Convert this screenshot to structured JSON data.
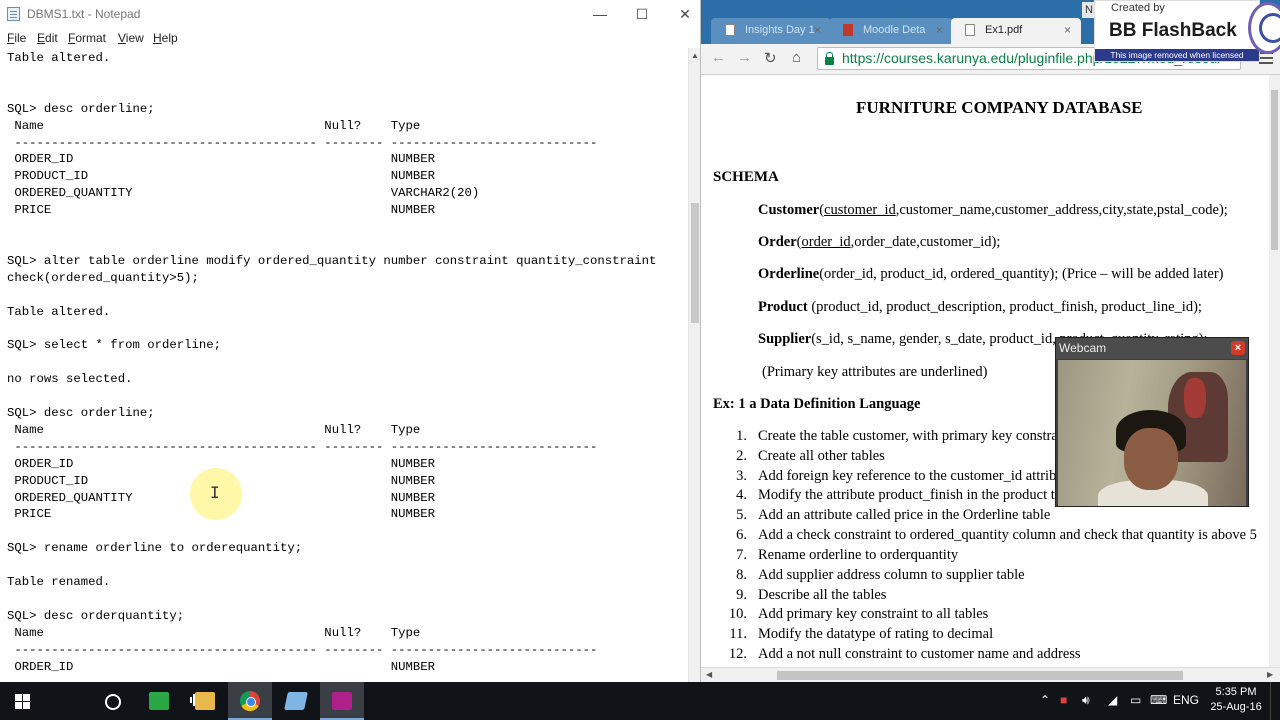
{
  "notepad": {
    "title": "DBMS1.txt - Notepad",
    "controls": {
      "minimize": "—",
      "maximize": "☐",
      "close": "✕"
    },
    "menu": [
      {
        "first": "F",
        "rest": "ile"
      },
      {
        "first": "E",
        "rest": "dit"
      },
      {
        "first": "F",
        "rest": "ormat"
      },
      {
        "first": "V",
        "rest": "iew"
      },
      {
        "first": "H",
        "rest": "elp"
      }
    ],
    "content": "Table altered.\n\n\nSQL> desc orderline;\n Name                                      Null?    Type\n ----------------------------------------- -------- ----------------------------\n ORDER_ID                                           NUMBER\n PRODUCT_ID                                         NUMBER\n ORDERED_QUANTITY                                   VARCHAR2(20)\n PRICE                                              NUMBER\n\n\nSQL> alter table orderline modify ordered_quantity number constraint quantity_constraint\ncheck(ordered_quantity>5);\n\nTable altered.\n\nSQL> select * from orderline;\n\nno rows selected.\n\nSQL> desc orderline;\n Name                                      Null?    Type\n ----------------------------------------- -------- ----------------------------\n ORDER_ID                                           NUMBER\n PRODUCT_ID                                         NUMBER\n ORDERED_QUANTITY                                   NUMBER\n PRICE                                              NUMBER\n\nSQL> rename orderline to orderequantity;\n\nTable renamed.\n\nSQL> desc orderquantity;\n Name                                      Null?    Type\n ----------------------------------------- -------- ----------------------------\n ORDER_ID                                           NUMBER"
  },
  "browser": {
    "tabs": [
      {
        "label": "Insights Day 1",
        "active": false
      },
      {
        "label": "Moodle Deta",
        "active": false
      },
      {
        "label": "Ex1.pdf",
        "active": true
      }
    ],
    "url": "https://courses.karunya.edu/pluginfile.php/18227/mod_resour",
    "pdf": {
      "title": "FURNITURE COMPANY DATABASE",
      "schema_heading": "SCHEMA",
      "customer": {
        "name": "Customer",
        "open": "(",
        "key": "customer_id",
        "rest": ",customer_name,customer_address,city,state,pstal_code);"
      },
      "order": {
        "name": "Order",
        "open": "(",
        "key": "order_id",
        "rest": ",order_date,customer_id);"
      },
      "orderline": {
        "name": "Orderline",
        "rest": "(order_id, product_id, ordered_quantity); (Price – will be added later)"
      },
      "product": {
        "name": "Product",
        "rest": " (product_id, product_description, product_finish, product_line_id);"
      },
      "supplier": {
        "name": "Supplier",
        "rest": "(s_id, s_name, gender, s_date, product_id, product_quantity, rating);"
      },
      "pk_note": "(Primary key attributes are underlined)",
      "exercise_heading": "Ex: 1 a Data Definition Language",
      "tasks": [
        {
          "num": "1.",
          "text": "Create the table customer, with primary key constraint"
        },
        {
          "num": "2.",
          "text": "Create all other tables"
        },
        {
          "num": "3.",
          "text": "Add foreign key reference to the customer_id attribute"
        },
        {
          "num": "4.",
          "text": "Modify the attribute product_finish in the product table"
        },
        {
          "num": "5.",
          "text": "Add an attribute called price in the Orderline table"
        },
        {
          "num": "6.",
          "text": "Add a check constraint to ordered_quantity column and check that quantity is above 5"
        },
        {
          "num": "7.",
          "text": "Rename orderline to orderquantity"
        },
        {
          "num": "8.",
          "text": "Add supplier address column to supplier table"
        },
        {
          "num": "9.",
          "text": "Describe all the tables"
        },
        {
          "num": "10.",
          "text": "Add primary key constraint to all tables"
        },
        {
          "num": "11.",
          "text": "Modify the datatype of rating to decimal"
        },
        {
          "num": "12.",
          "text": "Add a not null constraint to customer name and address"
        }
      ]
    }
  },
  "webcam": {
    "title": "Webcam",
    "close": "×"
  },
  "watermark": {
    "created_by": "Created by",
    "name": "BB FlashBack",
    "notice": "This image removed when licensed"
  },
  "corner_label": "N",
  "taskbar": {
    "language": "ENG",
    "time": "5:35 PM",
    "date": "25-Aug-16"
  }
}
